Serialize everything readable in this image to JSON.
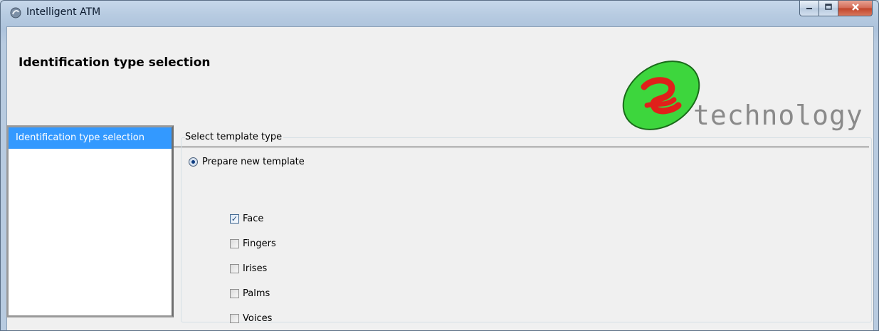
{
  "window": {
    "title": "Intelligent ATM",
    "app_icon": "app-icon",
    "controls": {
      "minimize_icon": "minimize-icon",
      "maximize_icon": "maximize-icon",
      "close_icon": "close-icon"
    }
  },
  "header": {
    "title": "Identification type selection",
    "logo_text": "technology"
  },
  "sidebar": {
    "items": [
      {
        "label": "Identification type selection",
        "selected": true
      }
    ]
  },
  "main": {
    "group_label": "Select template type",
    "radio": {
      "label": "Prepare new template",
      "checked": true
    },
    "modalities": [
      {
        "label": "Face",
        "checked": true
      },
      {
        "label": "Fingers",
        "checked": false
      },
      {
        "label": "Irises",
        "checked": false
      },
      {
        "label": "Palms",
        "checked": false
      },
      {
        "label": "Voices",
        "checked": false
      }
    ]
  },
  "colors": {
    "selection": "#3399ff",
    "logo_green": "#3dd63d",
    "logo_red": "#e0201a"
  }
}
